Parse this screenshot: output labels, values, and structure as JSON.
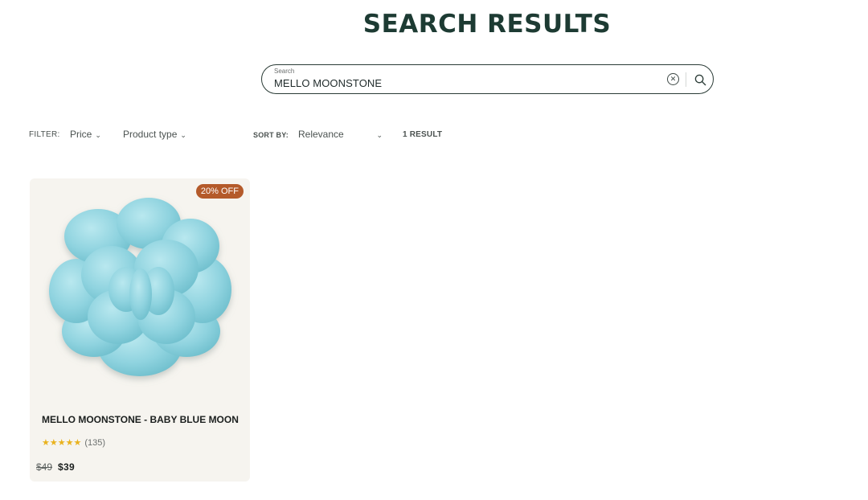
{
  "page": {
    "title": "SEARCH RESULTS"
  },
  "search": {
    "label": "Search",
    "value": "MELLO MOONSTONE",
    "clear_icon": "close-circle-icon",
    "submit_icon": "search-icon"
  },
  "filters": {
    "label": "FILTER:",
    "items": [
      {
        "label": "Price"
      },
      {
        "label": "Product type"
      }
    ]
  },
  "sort": {
    "label": "SORT BY:",
    "selected": "Relevance"
  },
  "results": {
    "count_text": "1 RESULT"
  },
  "products": [
    {
      "title": "MELLO MOONSTONE - BABY BLUE MOON",
      "badge": "20% OFF",
      "rating_stars": 5,
      "review_count": "(135)",
      "price_original": "$49",
      "price_sale": "$39"
    }
  ],
  "colors": {
    "title": "#1d3b33",
    "badge": "#b45a2a",
    "stars": "#e9b21d",
    "card_bg": "#f6f4ef",
    "plush": "#8fd3df"
  }
}
